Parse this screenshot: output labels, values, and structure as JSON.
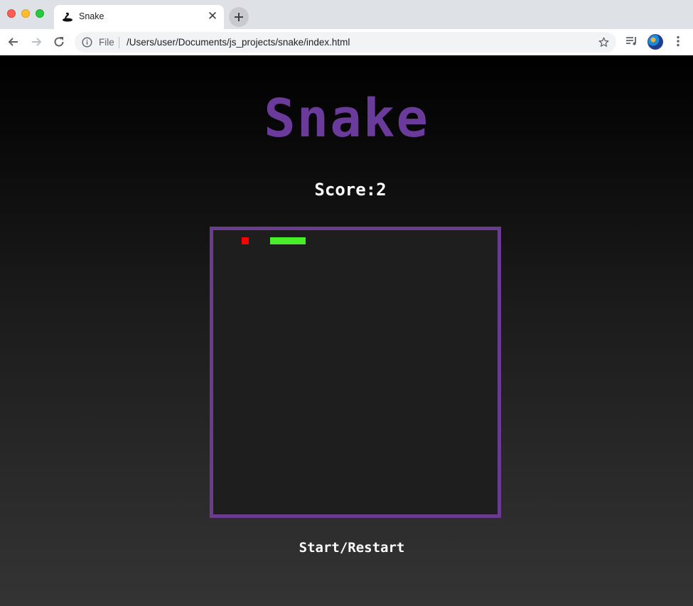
{
  "browser": {
    "tab_title": "Snake",
    "omnibox_scheme": "File",
    "url": "/Users/user/Documents/js_projects/snake/index.html",
    "icons": {
      "back": "arrow-left-icon",
      "forward": "arrow-right-icon",
      "reload": "reload-icon",
      "info": "info-icon",
      "bookmark": "star-icon",
      "media": "media-playlist-icon",
      "profile": "avatar",
      "menu": "kebab-menu-icon"
    }
  },
  "game": {
    "title": "Snake",
    "score_label": "Score:",
    "score_value": "2",
    "start_label": "Start/Restart",
    "colors": {
      "title": "#6a3b9b",
      "board_border": "#6a3b8f",
      "food": "#ff0000",
      "snake": "#49ee2b"
    }
  }
}
